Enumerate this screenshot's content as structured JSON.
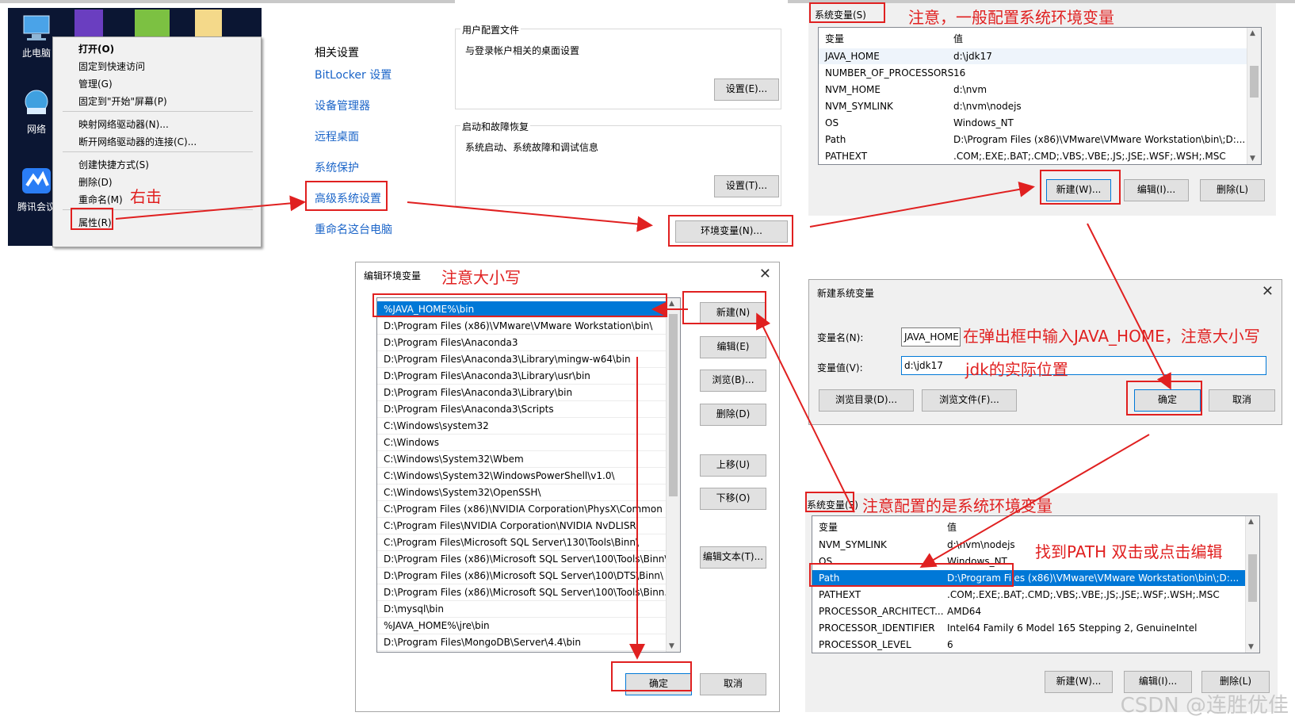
{
  "desktop": {
    "icons": [
      {
        "label": "此电脑"
      },
      {
        "label": "网络"
      },
      {
        "label": "腾讯会议"
      }
    ]
  },
  "context_menu": {
    "items": [
      "打开(O)",
      "固定到快速访问",
      "管理(G)",
      "固定到\"开始\"屏幕(P)",
      "映射网络驱动器(N)...",
      "断开网络驱动器的连接(C)...",
      "创建快捷方式(S)",
      "删除(D)",
      "重命名(M)",
      "属性(R)"
    ]
  },
  "related_settings": {
    "heading": "相关设置",
    "links": [
      "BitLocker 设置",
      "设备管理器",
      "远程桌面",
      "系统保护",
      "高级系统设置",
      "重命名这台电脑"
    ]
  },
  "sysprops": {
    "user_profile": {
      "legend": "用户配置文件",
      "desc": "与登录帐户相关的桌面设置",
      "button": "设置(E)..."
    },
    "startup": {
      "legend": "启动和故障恢复",
      "desc": "系统启动、系统故障和调试信息",
      "button": "设置(T)..."
    },
    "env_button": "环境变量(N)..."
  },
  "sysvars_top": {
    "label": "系统变量(S)",
    "col_var": "变量",
    "col_val": "值",
    "rows": [
      {
        "name": "JAVA_HOME",
        "value": "d:\\jdk17"
      },
      {
        "name": "NUMBER_OF_PROCESSORS",
        "value": "16"
      },
      {
        "name": "NVM_HOME",
        "value": "d:\\nvm"
      },
      {
        "name": "NVM_SYMLINK",
        "value": "d:\\nvm\\nodejs"
      },
      {
        "name": "OS",
        "value": "Windows_NT"
      },
      {
        "name": "Path",
        "value": "D:\\Program Files (x86)\\VMware\\VMware Workstation\\bin\\;D:..."
      },
      {
        "name": "PATHEXT",
        "value": ".COM;.EXE;.BAT;.CMD;.VBS;.VBE;.JS;.JSE;.WSF;.WSH;.MSC"
      }
    ],
    "buttons": [
      "新建(W)...",
      "编辑(I)...",
      "删除(L)"
    ]
  },
  "new_var_dialog": {
    "title": "新建系统变量",
    "name_label": "变量名(N):",
    "name_value": "JAVA_HOME",
    "value_label": "变量值(V):",
    "value_value": "d:\\jdk17",
    "buttons": [
      "浏览目录(D)...",
      "浏览文件(F)...",
      "确定",
      "取消"
    ]
  },
  "edit_env_dialog": {
    "title": "编辑环境变量",
    "entries": [
      "%JAVA_HOME%\\bin",
      "D:\\Program Files (x86)\\VMware\\VMware Workstation\\bin\\",
      "D:\\Program Files\\Anaconda3",
      "D:\\Program Files\\Anaconda3\\Library\\mingw-w64\\bin",
      "D:\\Program Files\\Anaconda3\\Library\\usr\\bin",
      "D:\\Program Files\\Anaconda3\\Library\\bin",
      "D:\\Program Files\\Anaconda3\\Scripts",
      "C:\\Windows\\system32",
      "C:\\Windows",
      "C:\\Windows\\System32\\Wbem",
      "C:\\Windows\\System32\\WindowsPowerShell\\v1.0\\",
      "C:\\Windows\\System32\\OpenSSH\\",
      "C:\\Program Files (x86)\\NVIDIA Corporation\\PhysX\\Common",
      "C:\\Program Files\\NVIDIA Corporation\\NVIDIA NvDLISR",
      "C:\\Program Files\\Microsoft SQL Server\\130\\Tools\\Binn\\",
      "D:\\Program Files (x86)\\Microsoft SQL Server\\100\\Tools\\Binn\\",
      "D:\\Program Files (x86)\\Microsoft SQL Server\\100\\DTS\\Binn\\",
      "D:\\Program Files (x86)\\Microsoft SQL Server\\100\\Tools\\Binn...",
      "D:\\mysql\\bin",
      "%JAVA_HOME%\\jre\\bin",
      "D:\\Program Files\\MongoDB\\Server\\4.4\\bin"
    ],
    "side_buttons": [
      "新建(N)",
      "编辑(E)",
      "浏览(B)...",
      "删除(D)",
      "上移(U)",
      "下移(O)",
      "编辑文本(T)..."
    ],
    "ok": "确定",
    "cancel": "取消"
  },
  "sysvars_bottom": {
    "label": "系统变量(S)",
    "col_var": "变量",
    "col_val": "值",
    "rows": [
      {
        "name": "NVM_SYMLINK",
        "value": "d:\\nvm\\nodejs"
      },
      {
        "name": "OS",
        "value": "Windows_NT"
      },
      {
        "name": "Path",
        "value": "D:\\Program Files (x86)\\VMware\\VMware Workstation\\bin\\;D:..."
      },
      {
        "name": "PATHEXT",
        "value": ".COM;.EXE;.BAT;.CMD;.VBS;.VBE;.JS;.JSE;.WSF;.WSH;.MSC"
      },
      {
        "name": "PROCESSOR_ARCHITECT...",
        "value": "AMD64"
      },
      {
        "name": "PROCESSOR_IDENTIFIER",
        "value": "Intel64 Family 6 Model 165 Stepping 2, GenuineIntel"
      },
      {
        "name": "PROCESSOR_LEVEL",
        "value": "6"
      }
    ],
    "buttons": [
      "新建(W)...",
      "编辑(I)...",
      "删除(L)"
    ]
  },
  "annotations": {
    "right_click": "右击",
    "top_note": "注意，一般配置系统环境变量",
    "case_note": "注意大小写",
    "input_note": "在弹出框中输入JAVA_HOME，注意大小写",
    "jdk_note": "jdk的实际位置",
    "sys_note": "注意配置的是系统环境变量",
    "path_note": "找到PATH 双击或点击编辑"
  },
  "watermark": "CSDN @连胜优佳",
  "colors": {
    "annotation": "#e02020",
    "selection": "#0078d7",
    "link": "#1a64c8"
  }
}
